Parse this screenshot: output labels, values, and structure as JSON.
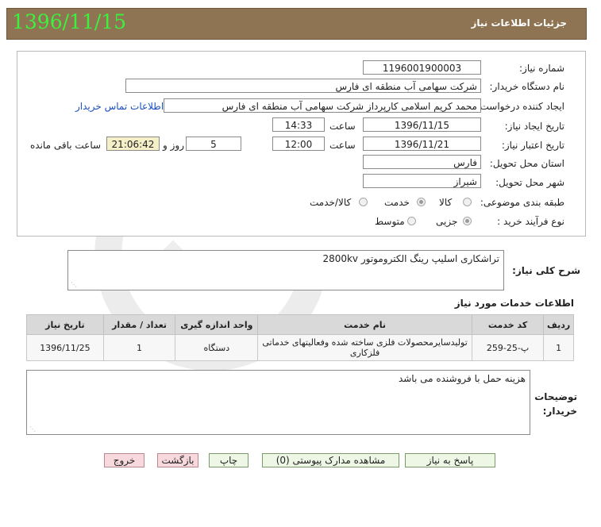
{
  "header": {
    "title": "جزئیات اطلاعات نیاز",
    "date": "1396/11/15"
  },
  "form": {
    "need_number": {
      "label": "شماره نیاز:",
      "value": "1196001900003"
    },
    "buyer_org": {
      "label": "نام دستگاه خریدار:",
      "value": "شرکت سهامی آب منطقه ای فارس"
    },
    "requester": {
      "label": "ایجاد کننده درخواست:",
      "value": "محمد کریم اسلامی کارپرداز شرکت سهامی آب منطقه ای فارس",
      "contact_link": "اطلاعات تماس خریدار"
    },
    "created": {
      "label": "تاریخ ایجاد نیاز:",
      "date": "1396/11/15",
      "time_label": "ساعت",
      "time": "14:33"
    },
    "validity": {
      "label": "تاریخ اعتبار نیاز:",
      "date": "1396/11/21",
      "time_label": "ساعت",
      "time": "12:00",
      "days": "5",
      "days_label": "روز و",
      "remaining": "21:06:42",
      "remaining_label": "ساعت باقی مانده"
    },
    "province": {
      "label": "استان محل تحویل:",
      "value": "فارس"
    },
    "city": {
      "label": "شهر محل تحویل:",
      "value": "شیراز"
    },
    "category": {
      "label": "طبقه بندی موضوعی:",
      "options": [
        "کالا",
        "خدمت",
        "کالا/خدمت"
      ],
      "selected": "خدمت"
    },
    "process": {
      "label": "نوع فرآیند خرید :",
      "options": [
        "جزیی",
        "متوسط"
      ],
      "selected": "جزیی"
    }
  },
  "summary": {
    "label": "شرح کلی نیاز:",
    "value": "تراشکاری اسلیپ رینگ الکتروموتور 2800kv"
  },
  "services": {
    "title": "اطلاعات خدمات مورد نیاز",
    "columns": [
      "ردیف",
      "کد خدمت",
      "نام خدمت",
      "واحد اندازه گیری",
      "تعداد / مقدار",
      "تاریخ نیاز"
    ],
    "rows": [
      {
        "index": "1",
        "code": "پ-25-259",
        "name": "تولیدسایرمحصولات فلزی ساخته شده وفعالیتهای خدماتی فلزکاری",
        "unit": "دستگاه",
        "qty": "1",
        "date": "1396/11/25"
      }
    ]
  },
  "notes": {
    "label": "توضیحات خریدار:",
    "value": "هزینه حمل با فروشنده می باشد"
  },
  "buttons": {
    "reply": "پاسخ به نیاز",
    "attachments": "مشاهده مدارک پیوستی (0)",
    "print": "چاپ",
    "back": "بازگشت",
    "exit": "خروج"
  },
  "colors": {
    "header_bg": "#8e7453",
    "date_green": "#3ef03e",
    "link_blue": "#1a4fc0",
    "highlight": "#f5f0c8"
  }
}
